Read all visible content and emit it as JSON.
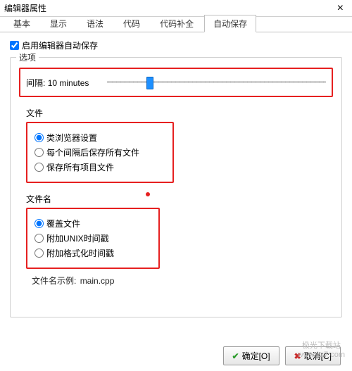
{
  "window": {
    "title": "编辑器属性"
  },
  "tabs": {
    "items": [
      {
        "label": "基本"
      },
      {
        "label": "显示"
      },
      {
        "label": "语法"
      },
      {
        "label": "代码"
      },
      {
        "label": "代码补全"
      },
      {
        "label": "自动保存"
      }
    ],
    "active_index": 5
  },
  "autosave": {
    "enable_label": "启用编辑器自动保存",
    "enable_checked": true,
    "options_group_title": "选项",
    "interval_label_prefix": "间隔:",
    "interval_value": "10 minutes",
    "slider_percent": 18,
    "file_section_label": "文件",
    "file_radios": [
      {
        "label": "类浏览器设置",
        "checked": true
      },
      {
        "label": "每个间隔后保存所有文件",
        "checked": false
      },
      {
        "label": "保存所有项目文件",
        "checked": false
      }
    ],
    "filename_section_label": "文件名",
    "filename_radios": [
      {
        "label": "覆盖文件",
        "checked": true
      },
      {
        "label": "附加UNIX时间戳",
        "checked": false
      },
      {
        "label": "附加格式化时间戳",
        "checked": false
      }
    ],
    "example_prefix": "文件名示例:",
    "example_value": "main.cpp"
  },
  "buttons": {
    "ok": "确定[O]",
    "cancel": "取消[C]"
  },
  "watermark": {
    "line1": "极光下载站",
    "line2": "www.xz7.com"
  }
}
